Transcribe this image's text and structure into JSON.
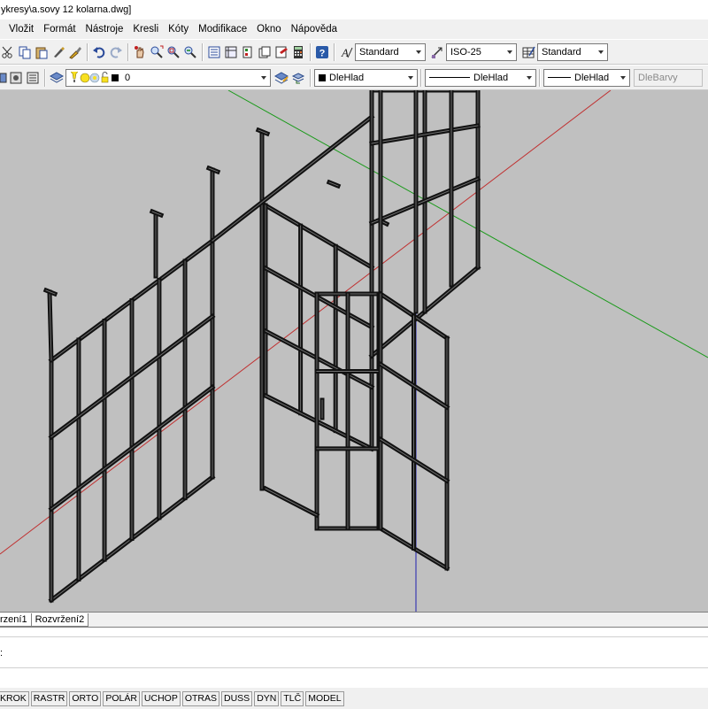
{
  "title": "ykresy\\a.sovy 12 kolarna.dwg]",
  "menu": [
    "Vložit",
    "Formát",
    "Nástroje",
    "Kresli",
    "Kóty",
    "Modifikace",
    "Okno",
    "Nápověda"
  ],
  "toolbar1": {
    "icons": [
      "cut-icon",
      "copy-icon",
      "paste-icon",
      "match-properties-icon",
      "brush-icon",
      "undo-icon",
      "redo-icon",
      "pan-icon",
      "zoom-realtime-icon",
      "zoom-window-icon",
      "zoom-previous-icon",
      "properties-icon",
      "design-center-icon",
      "tool-palettes-icon",
      "sheet-set-icon",
      "markup-icon",
      "calculator-icon",
      "help-icon"
    ],
    "text_style": "Standard",
    "dim_style": "ISO-25",
    "table_style": "Standard"
  },
  "toolbar2": {
    "layer_value": "0",
    "color": "DleHlad",
    "linetype": "DleHlad",
    "lineweight": "DleHlad",
    "plot_style": "DleBarvy"
  },
  "colors": {
    "viewport_bg": "#c0c0c0",
    "axis_red": "#c03030",
    "axis_green": "#1a9a1a",
    "axis_blue": "#2020b0",
    "frame": "#111111"
  },
  "tabs": [
    "rzení1",
    "Rozvržení2"
  ],
  "command": {
    "prompt": ":"
  },
  "status": [
    "KROK",
    "RASTR",
    "ORTO",
    "POLÁR",
    "UCHOP",
    "OTRAS",
    "DUSS",
    "DYN",
    "TLČ",
    "MODEL"
  ]
}
